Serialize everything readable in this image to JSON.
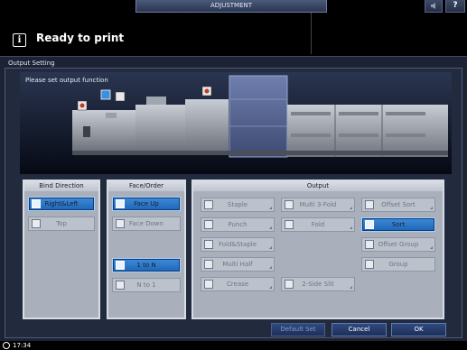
{
  "topbar": {
    "tab_label": "ADJUSTMENT",
    "help_label": "?"
  },
  "status": {
    "message": "Ready to print",
    "icon": "info-icon"
  },
  "panel": {
    "title": "Output Setting",
    "instruction": "Please set output function"
  },
  "bind_direction": {
    "header": "Bind Direction",
    "options": [
      {
        "label": "Right&Left",
        "selected": true,
        "enabled": true
      },
      {
        "label": "Top",
        "selected": false,
        "enabled": false
      }
    ]
  },
  "face_order": {
    "header": "Face/Order",
    "face": [
      {
        "label": "Face Up",
        "selected": true,
        "enabled": true
      },
      {
        "label": "Face Down",
        "selected": false,
        "enabled": false
      }
    ],
    "order": [
      {
        "label": "1 to N",
        "selected": true,
        "enabled": true
      },
      {
        "label": "N to 1",
        "selected": false,
        "enabled": false
      }
    ]
  },
  "output": {
    "header": "Output",
    "buttons": {
      "staple": "Staple",
      "multi_3fold": "Multi 3-Fold",
      "offset_sort": "Offset Sort",
      "punch": "Punch",
      "fold": "Fold",
      "sort": "Sort",
      "fold_staple": "Fold&Staple",
      "offset_group": "Offset Group",
      "multi_half": "Multi Half",
      "group": "Group",
      "crease": "Crease",
      "side_slit": "2-Side Slit"
    },
    "selected": "Sort"
  },
  "actions": {
    "default_set": "Default Set",
    "cancel": "Cancel",
    "ok": "OK"
  },
  "footer": {
    "time": "17:34"
  }
}
